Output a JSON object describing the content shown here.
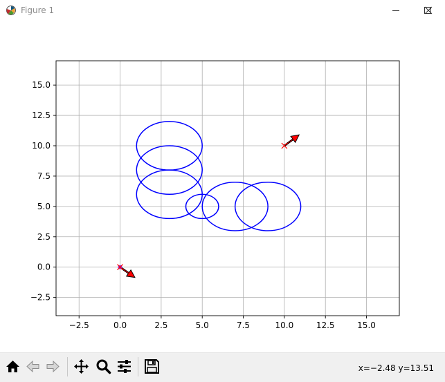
{
  "window": {
    "title": "Figure 1",
    "controls": [
      "minimize",
      "maximize",
      "close"
    ]
  },
  "toolbar": {
    "buttons": [
      {
        "name": "home-button",
        "icon": "home-icon"
      },
      {
        "name": "back-button",
        "icon": "back-arrow-icon"
      },
      {
        "name": "forward-button",
        "icon": "forward-arrow-icon"
      },
      {
        "name": "pan-button",
        "icon": "move-icon"
      },
      {
        "name": "zoom-button",
        "icon": "magnifier-icon"
      },
      {
        "name": "configure-subplots-button",
        "icon": "sliders-icon"
      },
      {
        "name": "save-button",
        "icon": "floppy-disk-icon"
      }
    ],
    "coords": "x=−2.48 y=13.51"
  },
  "chart_data": {
    "type": "scatter",
    "title": "",
    "xlabel": "",
    "ylabel": "",
    "xlim": [
      -3.9,
      17
    ],
    "ylim": [
      -4,
      17
    ],
    "grid": true,
    "xticks": [
      -2.5,
      0.0,
      2.5,
      5.0,
      7.5,
      10.0,
      12.5,
      15.0
    ],
    "yticks": [
      -2.5,
      0.0,
      2.5,
      5.0,
      7.5,
      10.0,
      12.5,
      15.0
    ],
    "xtick_labels": [
      "−2.5",
      "0.0",
      "2.5",
      "5.0",
      "7.5",
      "10.0",
      "12.5",
      "15.0"
    ],
    "ytick_labels": [
      "−2.5",
      "0.0",
      "2.5",
      "5.0",
      "7.5",
      "10.0",
      "12.5",
      "15.0"
    ],
    "circles": [
      {
        "cx": 3,
        "cy": 10,
        "r": 2,
        "color": "#0000ff"
      },
      {
        "cx": 3,
        "cy": 8,
        "r": 2,
        "color": "#0000ff"
      },
      {
        "cx": 3,
        "cy": 6,
        "r": 2,
        "color": "#0000ff"
      },
      {
        "cx": 5,
        "cy": 5,
        "r": 1,
        "color": "#0000ff"
      },
      {
        "cx": 7,
        "cy": 5,
        "r": 2,
        "color": "#0000ff"
      },
      {
        "cx": 9,
        "cy": 5,
        "r": 2,
        "color": "#0000ff"
      }
    ],
    "markers": [
      {
        "x": 0,
        "y": 0,
        "marker": "x",
        "color": "#ff0000"
      },
      {
        "x": 10,
        "y": 10,
        "marker": "x",
        "color": "#ff0000"
      }
    ],
    "arrows": [
      {
        "x": 0,
        "y": 0,
        "dx": 0.9,
        "dy": -0.85,
        "face": "#ff0000",
        "edge": "#000000"
      },
      {
        "x": 10,
        "y": 10,
        "dx": 0.9,
        "dy": 0.9,
        "face": "#ff0000",
        "edge": "#000000"
      }
    ],
    "path_points": [
      {
        "x": 0,
        "y": 0,
        "color": "#8a2be2"
      }
    ]
  }
}
